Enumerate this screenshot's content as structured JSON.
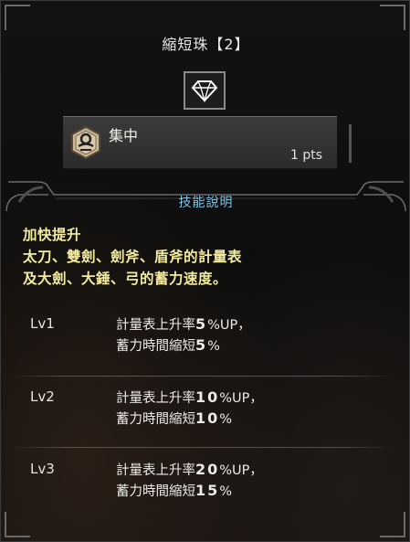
{
  "window": {
    "title_name": "縮短珠",
    "title_open": "【",
    "title_slot": "2",
    "title_close": "】"
  },
  "jewel": {
    "icon": "diamond-icon",
    "color": "#ffffff"
  },
  "skill": {
    "icon": "focus-skill-icon",
    "name": "集中",
    "points": "1 pts"
  },
  "description": {
    "header": "技能說明",
    "lines": [
      "加快提升",
      "太刀、雙劍、劍斧、盾斧的計量表",
      "及大劍、大錘、弓的蓄力速度。"
    ]
  },
  "levels": [
    {
      "label": "Lv1",
      "line1_text": "計量表上升率",
      "line1_num": "5",
      "line1_suffix": "%UP，",
      "line2_text": "蓄力時間縮短",
      "line2_num": "5",
      "line2_suffix": "%"
    },
    {
      "label": "Lv2",
      "line1_text": "計量表上升率",
      "line1_num": "10",
      "line1_suffix": "%UP，",
      "line2_text": "蓄力時間縮短",
      "line2_num": "10",
      "line2_suffix": "%"
    },
    {
      "label": "Lv3",
      "line1_text": "計量表上升率",
      "line1_num": "20",
      "line1_suffix": "%UP，",
      "line2_text": "蓄力時間縮短",
      "line2_num": "15",
      "line2_suffix": "%"
    }
  ],
  "colors": {
    "description_header": "#7ec4e6",
    "description_text": "#f3eb9f",
    "body_text": "#ecebe6"
  }
}
